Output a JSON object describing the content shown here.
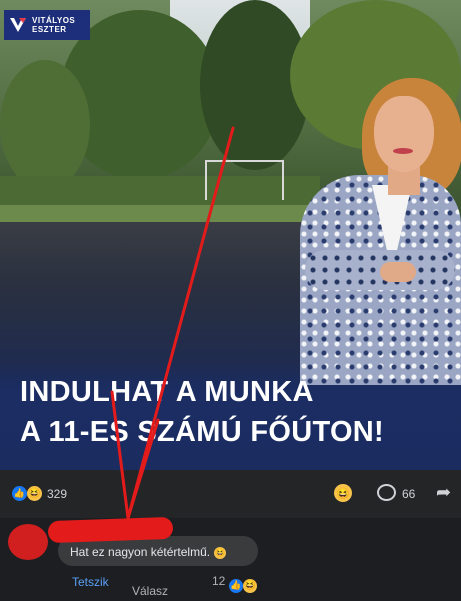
{
  "post": {
    "logo_line1": "VITÁLYOS",
    "logo_line2": "ESZTER",
    "headline_line1": "INDULHAT A MUNKA",
    "headline_line2": "A 11-ES SZÁMÚ FŐÚTON!"
  },
  "reactions": {
    "count": "329",
    "comments_count": "66",
    "icons": [
      "like-icon",
      "haha-icon"
    ]
  },
  "comment": {
    "text": "Hat ez nagyon kétértelmű.",
    "like_label": "Tetszik",
    "reply_label": "Válasz",
    "reaction_count": "12"
  },
  "colors": {
    "brand_blue": "#1d2f7a",
    "annotation_red": "#e31b1b",
    "like_blue": "#1877f2"
  }
}
